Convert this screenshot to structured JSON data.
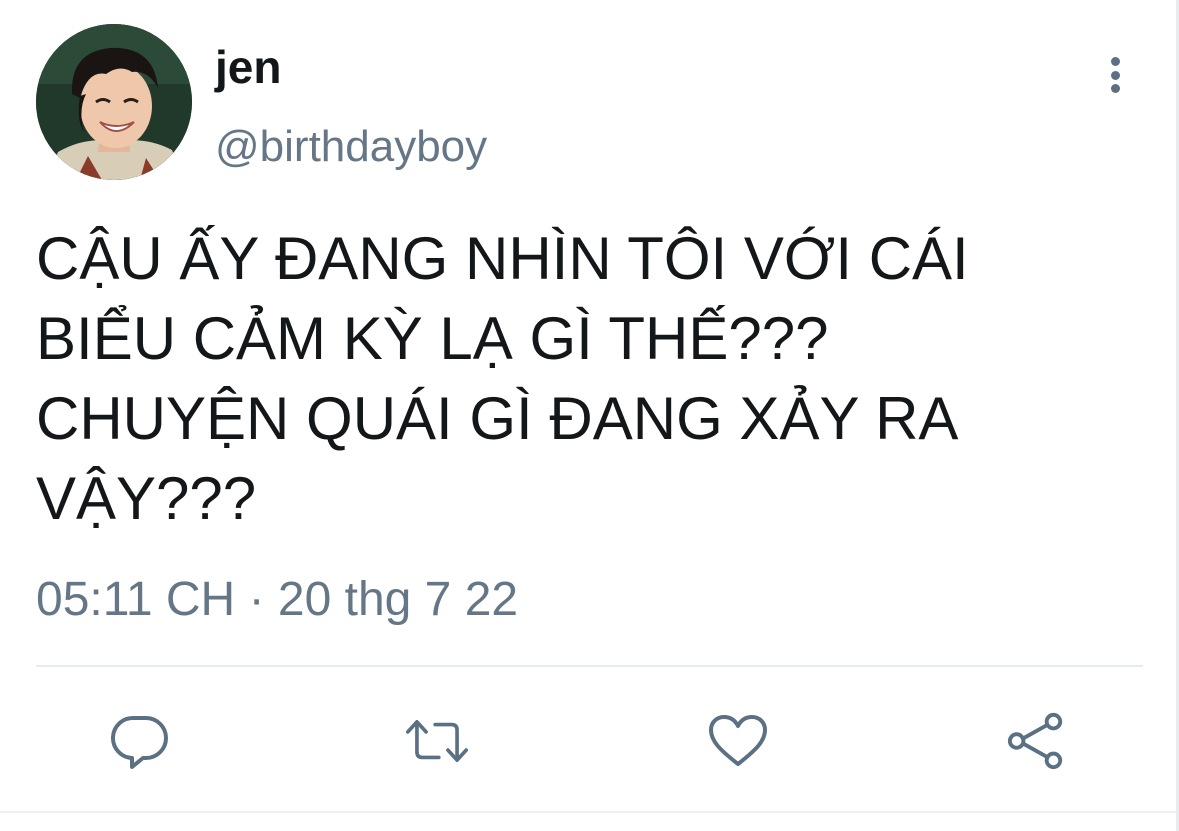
{
  "user": {
    "display_name": "jen",
    "handle": "@birthdayboy"
  },
  "tweet": {
    "text_lines": [
      "CẬU ẤY ĐANG NHÌN TÔI VỚI CÁI",
      "BIỂU CẢM KỲ LẠ GÌ THẾ???",
      "CHUYỆN QUÁI GÌ ĐANG XẢY RA",
      "VẬY???"
    ],
    "time": "05:11 CH",
    "separator": "·",
    "date": "20 thg 7 22"
  },
  "actions": [
    {
      "name": "reply",
      "icon": "reply-icon"
    },
    {
      "name": "retweet",
      "icon": "retweet-icon"
    },
    {
      "name": "like",
      "icon": "heart-icon"
    },
    {
      "name": "share",
      "icon": "share-icon"
    }
  ],
  "colors": {
    "text": "#14171a",
    "secondary": "#657786",
    "icon": "#5b7083",
    "divider": "#e6ecf0"
  }
}
